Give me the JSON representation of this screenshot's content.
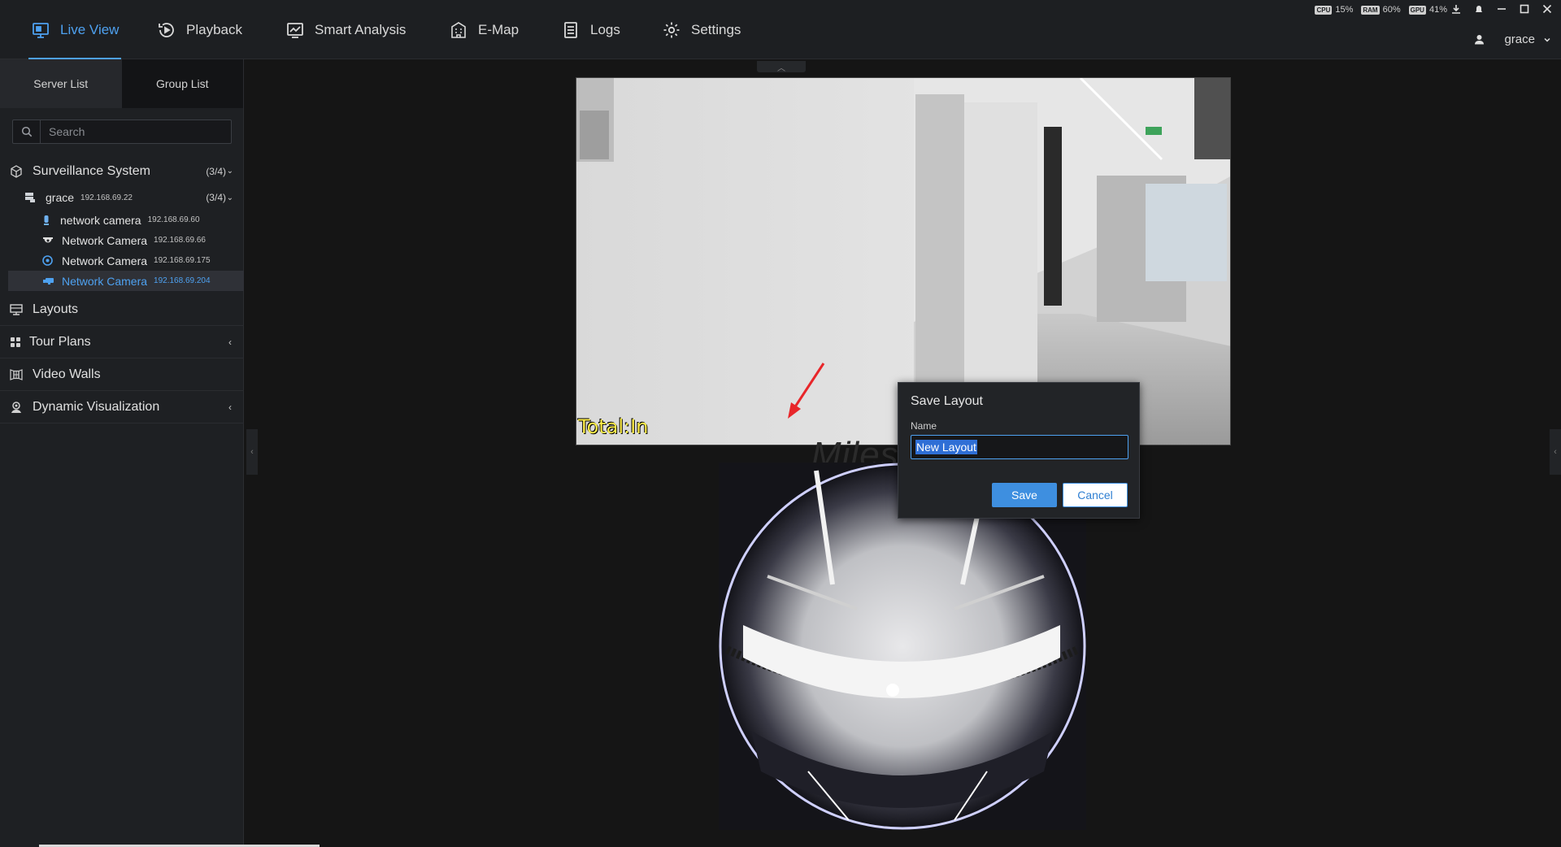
{
  "nav": {
    "items": [
      {
        "label": "Live View",
        "icon": "monitor-icon"
      },
      {
        "label": "Playback",
        "icon": "playback-icon"
      },
      {
        "label": "Smart Analysis",
        "icon": "chart-icon"
      },
      {
        "label": "E-Map",
        "icon": "building-icon"
      },
      {
        "label": "Logs",
        "icon": "list-icon"
      },
      {
        "label": "Settings",
        "icon": "gear-icon"
      }
    ],
    "active": "Live View"
  },
  "system": {
    "cpu": "15%",
    "ram": "60%",
    "gpu": "41%",
    "cpu_chip": "CPU",
    "ram_chip": "RAM",
    "gpu_chip": "GPU"
  },
  "user": {
    "name": "grace"
  },
  "sidebar": {
    "tabs": [
      "Server List",
      "Group List"
    ],
    "search_placeholder": "Search",
    "system": {
      "label": "Surveillance System",
      "count": "(3/4)"
    },
    "server": {
      "label": "grace",
      "ip": "192.168.69.22",
      "count": "(3/4)"
    },
    "cameras": [
      {
        "label": "network camera",
        "ip": "192.168.69.60"
      },
      {
        "label": "Network Camera",
        "ip": "192.168.69.66"
      },
      {
        "label": "Network Camera",
        "ip": "192.168.69.175"
      },
      {
        "label": "Network Camera",
        "ip": "192.168.69.204"
      }
    ],
    "sections": [
      "Layouts",
      "Tour Plans",
      "Video Walls",
      "Dynamic Visualization"
    ]
  },
  "video": {
    "overlay_text": "Total:In",
    "watermark": "Milesight"
  },
  "dialog": {
    "title": "Save Layout",
    "name_label": "Name",
    "name_value": "New Layout",
    "save_label": "Save",
    "cancel_label": "Cancel"
  },
  "colors": {
    "accent": "#4ea1f0",
    "annotation_arrow": "#e8262a"
  }
}
